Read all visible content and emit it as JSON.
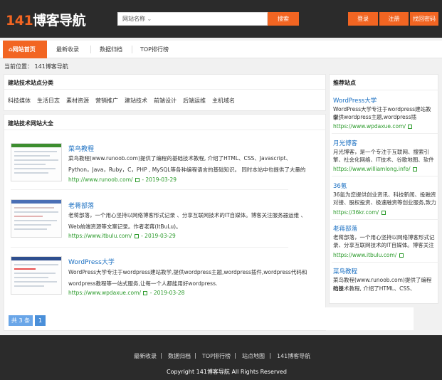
{
  "header": {
    "logo_num": "141",
    "logo_text": "博客导航",
    "search_select": "网站名称",
    "search_button": "搜索",
    "buttons": [
      "登录",
      "注册",
      "找回密码"
    ]
  },
  "nav": {
    "items": [
      "网站首页",
      "最新收录",
      "数据归档",
      "TOP排行榜"
    ]
  },
  "breadcrumb": "当前位置： 141博客导航",
  "categories": {
    "title": "建站技术站点分类",
    "items": [
      "科技媒体",
      "生活日志",
      "素材资源",
      "营销推广",
      "建站技术",
      "前端设计",
      "后端运维",
      "主机域名"
    ]
  },
  "sites": {
    "title": "建站技术网站大全",
    "entries": [
      {
        "title": "菜鸟教程",
        "desc1": "菜鸟教程(www.runoob.com)提供了编程的基础技术教程, 介绍了HTML、CSS、Javascript、",
        "desc2": "Python，Java，Ruby，C，PHP , MySQL等各种编程语言的基础知识。 同时本站中也提供了大量的",
        "url": "http://www.runoob.com/",
        "date": "- 2019-03-29"
      },
      {
        "title": "老蒋部落",
        "desc1": "老蒋部落，一个用心坚持以网络博客形式记录 、分享互联网技术的IT自媒体。博客关注服务器运维 、",
        "desc2": "Web前端资源等文案记录。作者老蒋(ItBuLu)。",
        "url": "https://www.itbulu.com/",
        "date": "- 2019-03-29"
      },
      {
        "title": "WordPress大学",
        "desc1": "WordPress大学专注于wordpress建站教学,提供wordpress主题,wordpress插件,wordpress代码和",
        "desc2": "wordpress教程等一站式服务,让每一个人都能用好wordpress.",
        "url": "https://www.wpdaxue.com/",
        "date": "- 2019-03-28"
      }
    ],
    "pager_total": "共 3 条",
    "pager_page": "1"
  },
  "sidebar": {
    "title": "推荐站点",
    "items": [
      {
        "title": "WordPress大学",
        "desc1": "WordPress大学专注于wordpress建站教学,",
        "desc2": "提供wordpress主题,wordpress插",
        "url": "https://www.wpdaxue.com/"
      },
      {
        "title": "月光博客",
        "desc1": "月光博客，是一个专注于互联网、搜索引",
        "desc2": "擎、社会化网络、IT技术、谷歌地图、软件",
        "url": "https://www.williamlong.info/"
      },
      {
        "title": "36氪",
        "desc1": "36氪为您提供创业资讯、科技新闻、投融资",
        "desc2": "对接、股权投资、极速融资等创业服务,致力",
        "url": "https://36kr.com/"
      },
      {
        "title": "老蒋部落",
        "desc1": "老蒋部落，一个用心坚持以网络博客形式记",
        "desc2": "录、分享互联网技术的IT自媒体。博客关注",
        "url": "https://www.itbulu.com/"
      },
      {
        "title": "菜鸟教程",
        "desc1": "菜鸟教程(www.runoob.com)提供了编程的基",
        "desc2": "础技术教程, 介绍了HTML、CSS、",
        "url": ""
      }
    ]
  },
  "footer": {
    "links": [
      "最新收录",
      "数据归档",
      "TOP排行榜",
      "站点地图",
      "141博客导航"
    ],
    "sep": "|",
    "copyright": "Copyright 141博客导航 All Rights Reserved"
  },
  "colors": {
    "accent": "#f26522",
    "header_bg": "#2b2b2b",
    "link": "#1a6fc2",
    "url": "#2a9a2a"
  }
}
